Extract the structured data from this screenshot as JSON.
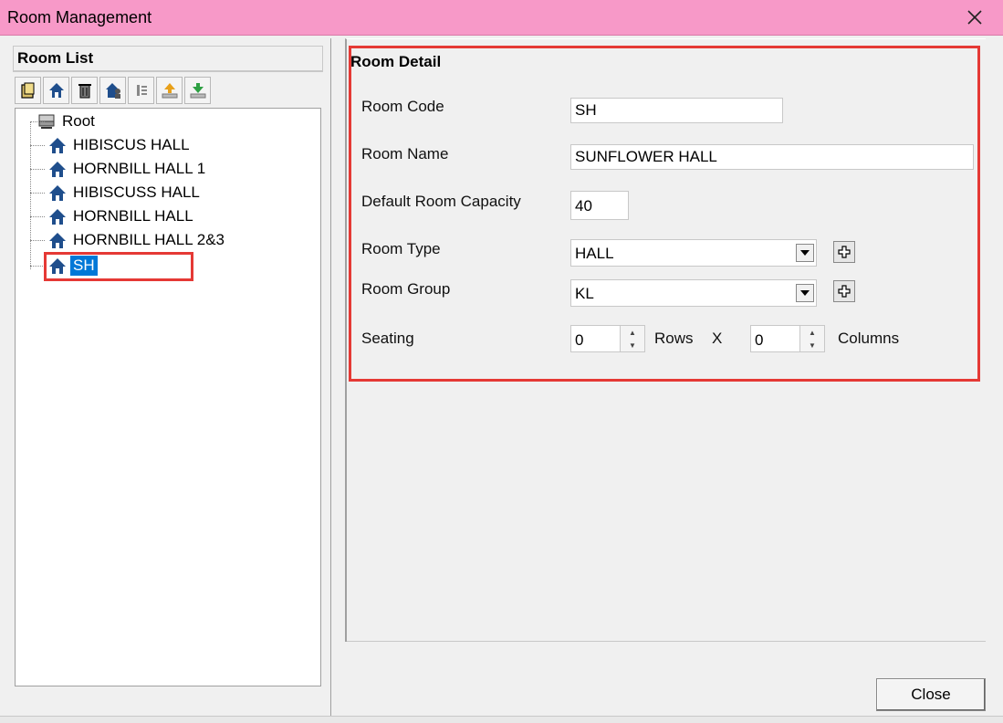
{
  "window": {
    "title": "Room Management"
  },
  "room_list": {
    "header": "Room List",
    "toolbar": [
      "folder-icon",
      "home-icon",
      "delete-icon",
      "room-user-icon",
      "list-icon",
      "upload-icon",
      "download-icon"
    ],
    "tree": {
      "root": "Root",
      "items": [
        "HIBISCUS HALL",
        "HORNBILL HALL 1",
        "HIBISCUSS HALL",
        "HORNBILL HALL",
        "HORNBILL HALL 2&3",
        "SH"
      ],
      "selected": "SH"
    }
  },
  "room_detail": {
    "title": "Room Detail",
    "room_code": {
      "label": "Room Code",
      "value": "SH"
    },
    "room_name": {
      "label": "Room Name",
      "value": "SUNFLOWER HALL"
    },
    "capacity": {
      "label": "Default Room Capacity",
      "value": "40"
    },
    "room_type": {
      "label": "Room Type",
      "value": "HALL"
    },
    "room_group": {
      "label": "Room Group",
      "value": "KL"
    },
    "seating": {
      "label": "Seating",
      "rows_value": "0",
      "rows_label": "Rows",
      "x_label": "X",
      "columns_value": "0",
      "columns_label": "Columns"
    }
  },
  "buttons": {
    "close": "Close"
  },
  "colors": {
    "titlebar": "#f799c8",
    "highlight": "#e53935",
    "selection": "#0078d7"
  }
}
